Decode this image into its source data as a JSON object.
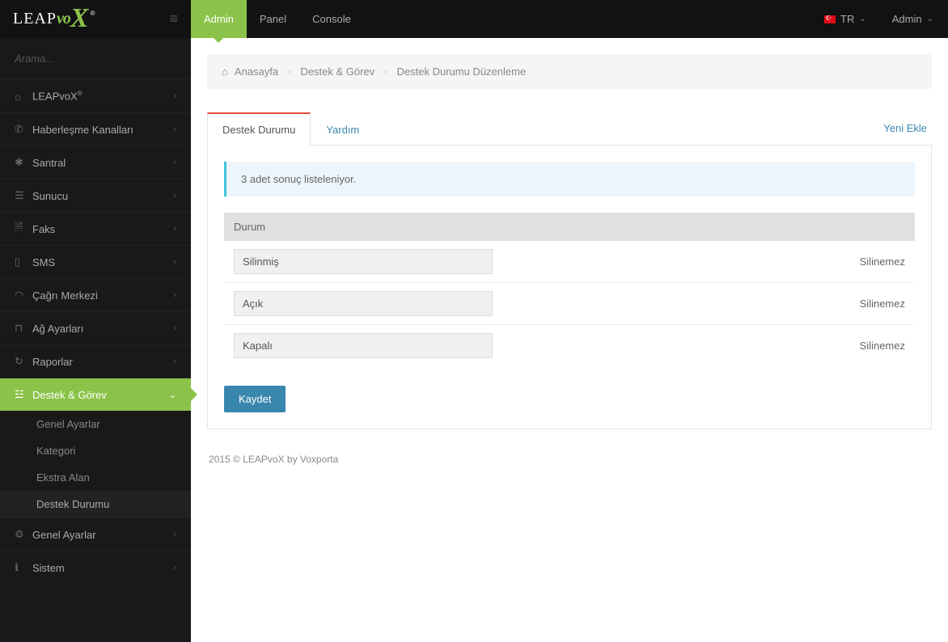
{
  "logo": {
    "leap": "LEAP",
    "vo": "vo",
    "x": "X",
    "r": "®"
  },
  "topnav": {
    "items": [
      {
        "label": "Admin",
        "active": true
      },
      {
        "label": "Panel"
      },
      {
        "label": "Console"
      }
    ]
  },
  "lang": {
    "code": "TR"
  },
  "user": {
    "name": "Admin"
  },
  "search": {
    "placeholder": "Arama..."
  },
  "sidebar": {
    "items": [
      {
        "icon": "home",
        "label": "LEAPvoX",
        "sup": "®"
      },
      {
        "icon": "phone",
        "label": "Haberleşme Kanalları"
      },
      {
        "icon": "asterisk",
        "label": "Santral"
      },
      {
        "icon": "server",
        "label": "Sunucu"
      },
      {
        "icon": "fax",
        "label": "Faks"
      },
      {
        "icon": "mobile",
        "label": "SMS"
      },
      {
        "icon": "headset",
        "label": "Çağrı Merkezi"
      },
      {
        "icon": "network",
        "label": "Ağ Ayarları"
      },
      {
        "icon": "history",
        "label": "Raporlar"
      },
      {
        "icon": "task",
        "label": "Destek & Görev",
        "active": true
      },
      {
        "icon": "gears",
        "label": "Genel Ayarlar"
      },
      {
        "icon": "info",
        "label": "Sistem"
      }
    ],
    "submenu": [
      {
        "label": "Genel Ayarlar"
      },
      {
        "label": "Kategori"
      },
      {
        "label": "Ekstra Alan"
      },
      {
        "label": "Destek Durumu",
        "active": true
      }
    ]
  },
  "breadcrumb": {
    "items": [
      "Anasayfa",
      "Destek & Görev",
      "Destek Durumu Düzenleme"
    ]
  },
  "tabs": {
    "items": [
      {
        "label": "Destek Durumu",
        "active": true
      },
      {
        "label": "Yardım"
      }
    ],
    "right": "Yeni Ekle"
  },
  "alert": "3 adet sonuç listeleniyor.",
  "table": {
    "header": "Durum",
    "rows": [
      {
        "value": "Silinmiş",
        "status": "Silinemez"
      },
      {
        "value": "Açık",
        "status": "Silinemez"
      },
      {
        "value": "Kapalı",
        "status": "Silinemez"
      }
    ]
  },
  "save_button": "Kaydet",
  "footer": "2015 © LEAPvoX by Voxporta",
  "icons": {
    "home": "⌂",
    "phone": "✆",
    "asterisk": "✱",
    "server": "☰",
    "fax": "🗎",
    "mobile": "▯",
    "headset": "◠",
    "network": "⊓",
    "history": "↻",
    "task": "☳",
    "gears": "⚙",
    "info": "ℹ",
    "chevr": "›",
    "chevd": "⌄",
    "hamburger": "≡",
    "bc_sep": "›"
  }
}
